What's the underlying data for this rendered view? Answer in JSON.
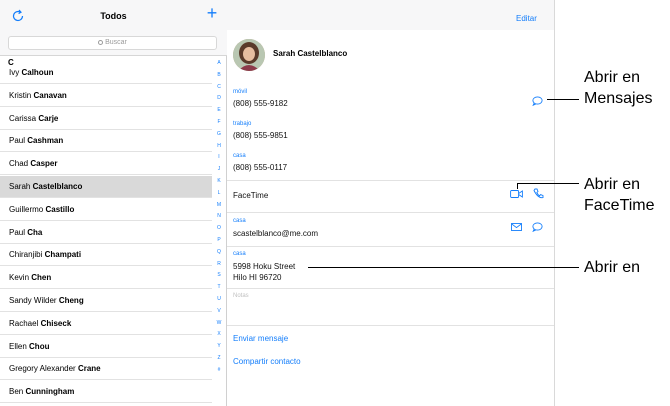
{
  "left_header": {
    "title": "Todos",
    "add_label": "+",
    "search_placeholder": "Buscar"
  },
  "section_letter": "C",
  "contacts": [
    {
      "first": "Ivy",
      "last": "Calhoun"
    },
    {
      "first": "Kristin",
      "last": "Canavan"
    },
    {
      "first": "Carissa",
      "last": "Carje"
    },
    {
      "first": "Paul",
      "last": "Cashman"
    },
    {
      "first": "Chad",
      "last": "Casper"
    },
    {
      "first": "Sarah",
      "last": "Castelblanco"
    },
    {
      "first": "Guillermo",
      "last": "Castillo"
    },
    {
      "first": "Paul",
      "last": "Cha"
    },
    {
      "first": "Chiranjibi",
      "last": "Champati"
    },
    {
      "first": "Kevin",
      "last": "Chen"
    },
    {
      "first": "Sandy Wilder",
      "last": "Cheng"
    },
    {
      "first": "Rachael",
      "last": "Chiseck"
    },
    {
      "first": "Ellen",
      "last": "Chou"
    },
    {
      "first": "Gregory Alexander",
      "last": "Crane"
    },
    {
      "first": "Ben",
      "last": "Cunningham"
    }
  ],
  "index_letters": [
    "A",
    "B",
    "C",
    "D",
    "E",
    "F",
    "G",
    "H",
    "I",
    "J",
    "K",
    "L",
    "M",
    "N",
    "O",
    "P",
    "Q",
    "R",
    "S",
    "T",
    "U",
    "V",
    "W",
    "X",
    "Y",
    "Z",
    "#"
  ],
  "detail": {
    "edit_label": "Editar",
    "name": "Sarah Castelblanco",
    "mobile_label": "móvil",
    "mobile": "(808) 555-9182",
    "work_label": "trabajo",
    "work": "(808) 555-9851",
    "home_label": "casa",
    "home": "(808) 555-0117",
    "facetime": "FaceTime",
    "email_label": "casa",
    "email": "scastelblanco@me.com",
    "address_label": "casa",
    "address_line1": "5998 Hoku Street",
    "address_line2": "Hilo HI 96720",
    "notes_label": "Notas",
    "send_message": "Enviar mensaje",
    "share_contact": "Compartir contacto"
  },
  "callouts": {
    "messages_line1": "Abrir en",
    "messages_line2": "Mensajes",
    "facetime_line1": "Abrir en",
    "facetime_line2": "FaceTime",
    "maps_line1": "Abrir en"
  },
  "colors": {
    "accent": "#147efb",
    "selected_row": "#d9d9d9",
    "bar": "#f7f7f8"
  }
}
